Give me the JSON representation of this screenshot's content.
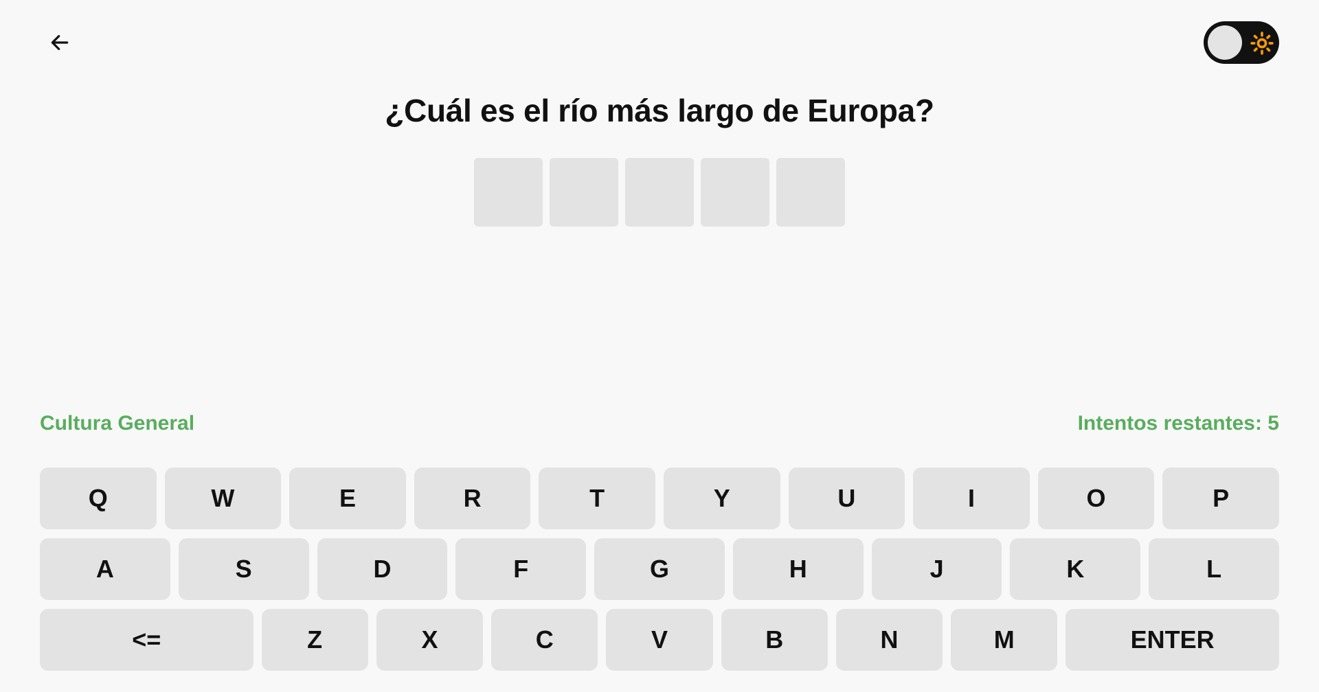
{
  "header": {
    "back_icon": "arrow-left-icon",
    "theme_toggle_icon": "sun-icon",
    "theme_toggle_accent": "#f59a0c"
  },
  "question": "¿Cuál es el río más largo de Europa?",
  "answer": {
    "slots": [
      "",
      "",
      "",
      "",
      ""
    ]
  },
  "status": {
    "category": "Cultura General",
    "attempts": "Intentos restantes: 5",
    "color": "#59ad5e"
  },
  "keyboard": {
    "row1": [
      "Q",
      "W",
      "E",
      "R",
      "T",
      "Y",
      "U",
      "I",
      "O",
      "P"
    ],
    "row2": [
      "A",
      "S",
      "D",
      "F",
      "G",
      "H",
      "J",
      "K",
      "L"
    ],
    "row3": [
      "<=",
      "Z",
      "X",
      "C",
      "V",
      "B",
      "N",
      "M",
      "ENTER"
    ]
  }
}
